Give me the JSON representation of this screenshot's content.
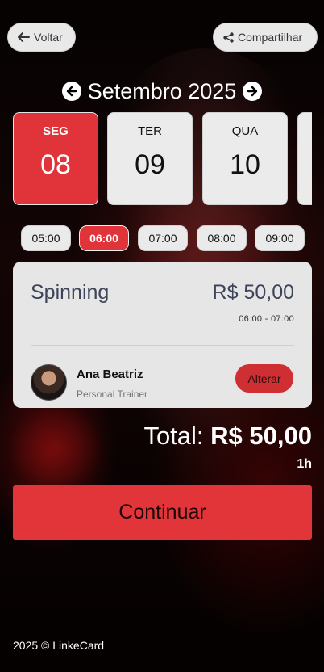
{
  "header": {
    "back_label": "Voltar",
    "share_label": "Compartilhar",
    "back_icon": "arrow-left-icon",
    "share_icon": "share-icon"
  },
  "calendar": {
    "month_label": "Setembro 2025",
    "prev_icon": "arrow-circle-left-icon",
    "next_icon": "arrow-circle-right-icon",
    "days": [
      {
        "dow": "SEG",
        "num": "08",
        "selected": true
      },
      {
        "dow": "TER",
        "num": "09",
        "selected": false
      },
      {
        "dow": "QUA",
        "num": "10",
        "selected": false
      }
    ]
  },
  "times": [
    {
      "label": "05:00",
      "selected": false
    },
    {
      "label": "06:00",
      "selected": true
    },
    {
      "label": "07:00",
      "selected": false
    },
    {
      "label": "08:00",
      "selected": false
    },
    {
      "label": "09:00",
      "selected": false
    }
  ],
  "service": {
    "name": "Spinning",
    "price": "R$ 50,00",
    "time_range": "06:00 - 07:00",
    "trainer_name": "Ana Beatriz",
    "trainer_role": "Personal Trainer",
    "change_label": "Alterar"
  },
  "summary": {
    "total_label": "Total:",
    "total_value": "R$ 50,00",
    "duration": "1h"
  },
  "actions": {
    "continue_label": "Continuar"
  },
  "footer": {
    "text": "2025 © LinkeCard"
  },
  "colors": {
    "accent": "#e0343a",
    "card_bg": "#e6e6e6",
    "text_dark": "#3d4459"
  }
}
